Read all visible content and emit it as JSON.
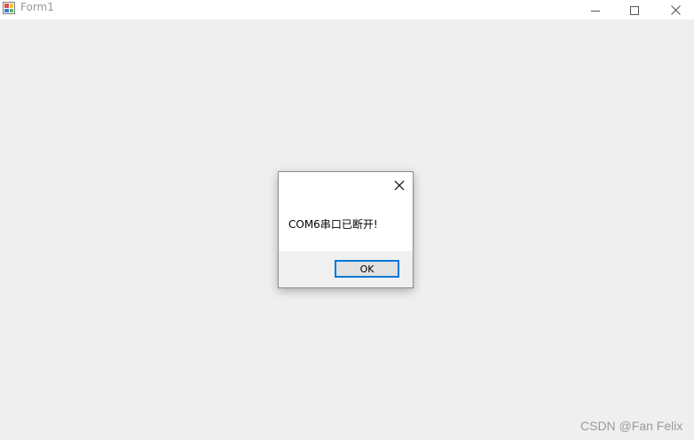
{
  "window": {
    "title": "Form1",
    "icon": "winforms-app-icon",
    "controls": {
      "minimize_icon": "minimize-icon",
      "maximize_icon": "maximize-icon",
      "close_icon": "close-icon"
    }
  },
  "dialog": {
    "message": "COM6串口已断开!",
    "ok_label": "OK",
    "close_icon": "close-icon"
  },
  "watermark": {
    "text": "CSDN @Fan Felix"
  },
  "colors": {
    "background": "#efefef",
    "accent": "#0078d7"
  }
}
